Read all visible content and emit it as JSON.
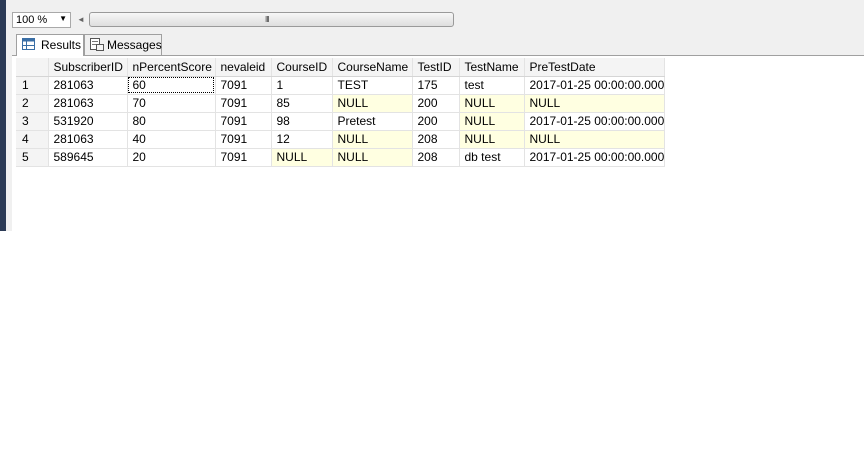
{
  "toolbar": {
    "zoom_value": "100 %",
    "scroll_grip": "III"
  },
  "tabs": [
    {
      "label": "Results",
      "icon": "results-grid-icon",
      "active": true
    },
    {
      "label": "Messages",
      "icon": "messages-icon",
      "active": false
    }
  ],
  "grid": {
    "columns": [
      "SubscriberID",
      "nPercentScore",
      "nevaleid",
      "CourseID",
      "CourseName",
      "TestID",
      "TestName",
      "PreTestDate"
    ],
    "rows": [
      {
        "num": "1",
        "cells": [
          "281063",
          "60",
          "7091",
          "1",
          "TEST",
          "175",
          "test",
          "2017-01-25 00:00:00.000"
        ]
      },
      {
        "num": "2",
        "cells": [
          "281063",
          "70",
          "7091",
          "85",
          "NULL",
          "200",
          "NULL",
          "NULL"
        ]
      },
      {
        "num": "3",
        "cells": [
          "531920",
          "80",
          "7091",
          "98",
          "Pretest",
          "200",
          "NULL",
          "2017-01-25 00:00:00.000"
        ]
      },
      {
        "num": "4",
        "cells": [
          "281063",
          "40",
          "7091",
          "12",
          "NULL",
          "208",
          "NULL",
          "NULL"
        ]
      },
      {
        "num": "5",
        "cells": [
          "589645",
          "20",
          "7091",
          "NULL",
          "NULL",
          "208",
          "db test",
          "2017-01-25 00:00:00.000"
        ]
      }
    ],
    "null_color": "#ffffe1"
  }
}
